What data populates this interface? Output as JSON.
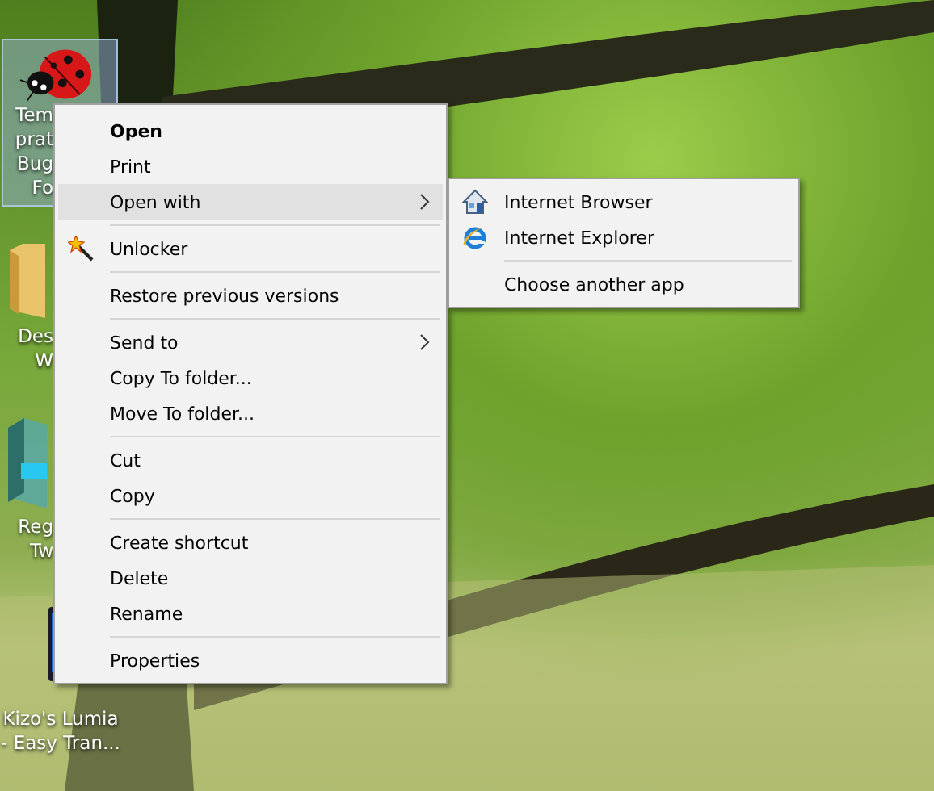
{
  "desktop_icons": [
    {
      "label_lines": [
        "Tem",
        "prat",
        "Bug",
        "Fo"
      ],
      "selected": true
    },
    {
      "label_lines": [
        "Des",
        "W"
      ],
      "selected": false
    },
    {
      "label_lines": [
        "Reg",
        "Tw"
      ],
      "selected": false
    },
    {
      "label_lines": [
        "Kizo's Lumia",
        "- Easy Tran..."
      ],
      "selected": false
    }
  ],
  "context_menu": {
    "groups": [
      [
        {
          "label": "Open",
          "default": true,
          "selected": false,
          "has_submenu": false,
          "has_icon": false
        },
        {
          "label": "Print",
          "default": false,
          "selected": false,
          "has_submenu": false,
          "has_icon": false
        },
        {
          "label": "Open with",
          "default": false,
          "selected": true,
          "has_submenu": true,
          "has_icon": false
        }
      ],
      [
        {
          "label": "Unlocker",
          "default": false,
          "selected": false,
          "has_submenu": false,
          "has_icon": true
        }
      ],
      [
        {
          "label": "Restore previous versions",
          "default": false,
          "selected": false,
          "has_submenu": false,
          "has_icon": false
        }
      ],
      [
        {
          "label": "Send to",
          "default": false,
          "selected": false,
          "has_submenu": true,
          "has_icon": false
        },
        {
          "label": "Copy To folder...",
          "default": false,
          "selected": false,
          "has_submenu": false,
          "has_icon": false
        },
        {
          "label": "Move To folder...",
          "default": false,
          "selected": false,
          "has_submenu": false,
          "has_icon": false
        }
      ],
      [
        {
          "label": "Cut",
          "default": false,
          "selected": false,
          "has_submenu": false,
          "has_icon": false
        },
        {
          "label": "Copy",
          "default": false,
          "selected": false,
          "has_submenu": false,
          "has_icon": false
        }
      ],
      [
        {
          "label": "Create shortcut",
          "default": false,
          "selected": false,
          "has_submenu": false,
          "has_icon": false
        },
        {
          "label": "Delete",
          "default": false,
          "selected": false,
          "has_submenu": false,
          "has_icon": false
        },
        {
          "label": "Rename",
          "default": false,
          "selected": false,
          "has_submenu": false,
          "has_icon": false
        }
      ],
      [
        {
          "label": "Properties",
          "default": false,
          "selected": false,
          "has_submenu": false,
          "has_icon": false
        }
      ]
    ]
  },
  "submenu": {
    "groups": [
      [
        {
          "label": "Internet Browser",
          "selected": false
        },
        {
          "label": "Internet Explorer",
          "selected": false
        }
      ],
      [
        {
          "label": "Choose another app",
          "selected": false
        }
      ]
    ]
  }
}
